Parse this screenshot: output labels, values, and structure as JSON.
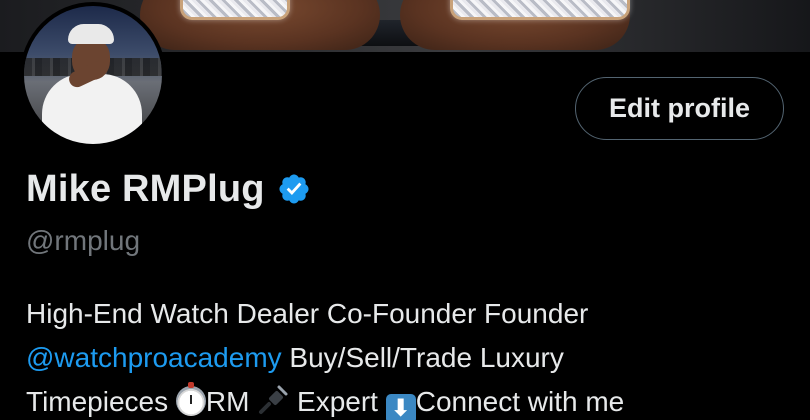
{
  "profile": {
    "display_name": "Mike RMPlug",
    "handle": "@rmplug",
    "verified": true,
    "edit_button_label": "Edit profile",
    "bio": {
      "part1": "High-End Watch Dealer Co-Founder Founder",
      "mention": "@watchproacademy",
      "part2": " Buy/Sell/Trade Luxury",
      "part3": "Timepieces ",
      "part4": "RM ",
      "part5": " Expert ",
      "part6": "Connect with me",
      "emojis": [
        "stopwatch-emoji",
        "plug-emoji",
        "down-arrow-emoji"
      ]
    }
  },
  "colors": {
    "background": "#000000",
    "text_primary": "#e7e9ea",
    "text_secondary": "#71767b",
    "link": "#1d9bf0",
    "verified_badge": "#1d9bf0",
    "button_border": "#536471"
  }
}
